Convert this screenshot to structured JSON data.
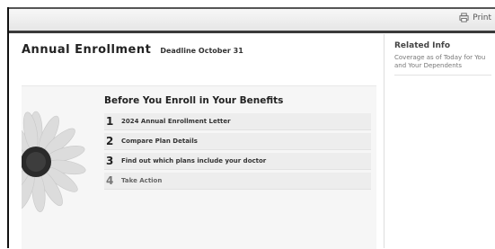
{
  "toolbar": {
    "print_label": "Print",
    "print_icon": "printer-icon"
  },
  "header": {
    "title": "Annual Enrollment",
    "deadline": "Deadline October 31"
  },
  "sidebar": {
    "title": "Related Info",
    "text": "Coverage as of Today for You and Your Dependents"
  },
  "panel": {
    "heading": "Before You Enroll in Your Benefits",
    "steps": [
      {
        "number": "1",
        "label": "2024 Annual Enrollment Letter"
      },
      {
        "number": "2",
        "label": "Compare Plan Details"
      },
      {
        "number": "3",
        "label": "Find out which plans include your doctor"
      },
      {
        "number": "4",
        "label": "Take Action"
      }
    ]
  },
  "colors": {
    "topbar_border": "#3a3a3a",
    "panel_bg": "#f6f6f6",
    "step_bg": "#ededed"
  }
}
